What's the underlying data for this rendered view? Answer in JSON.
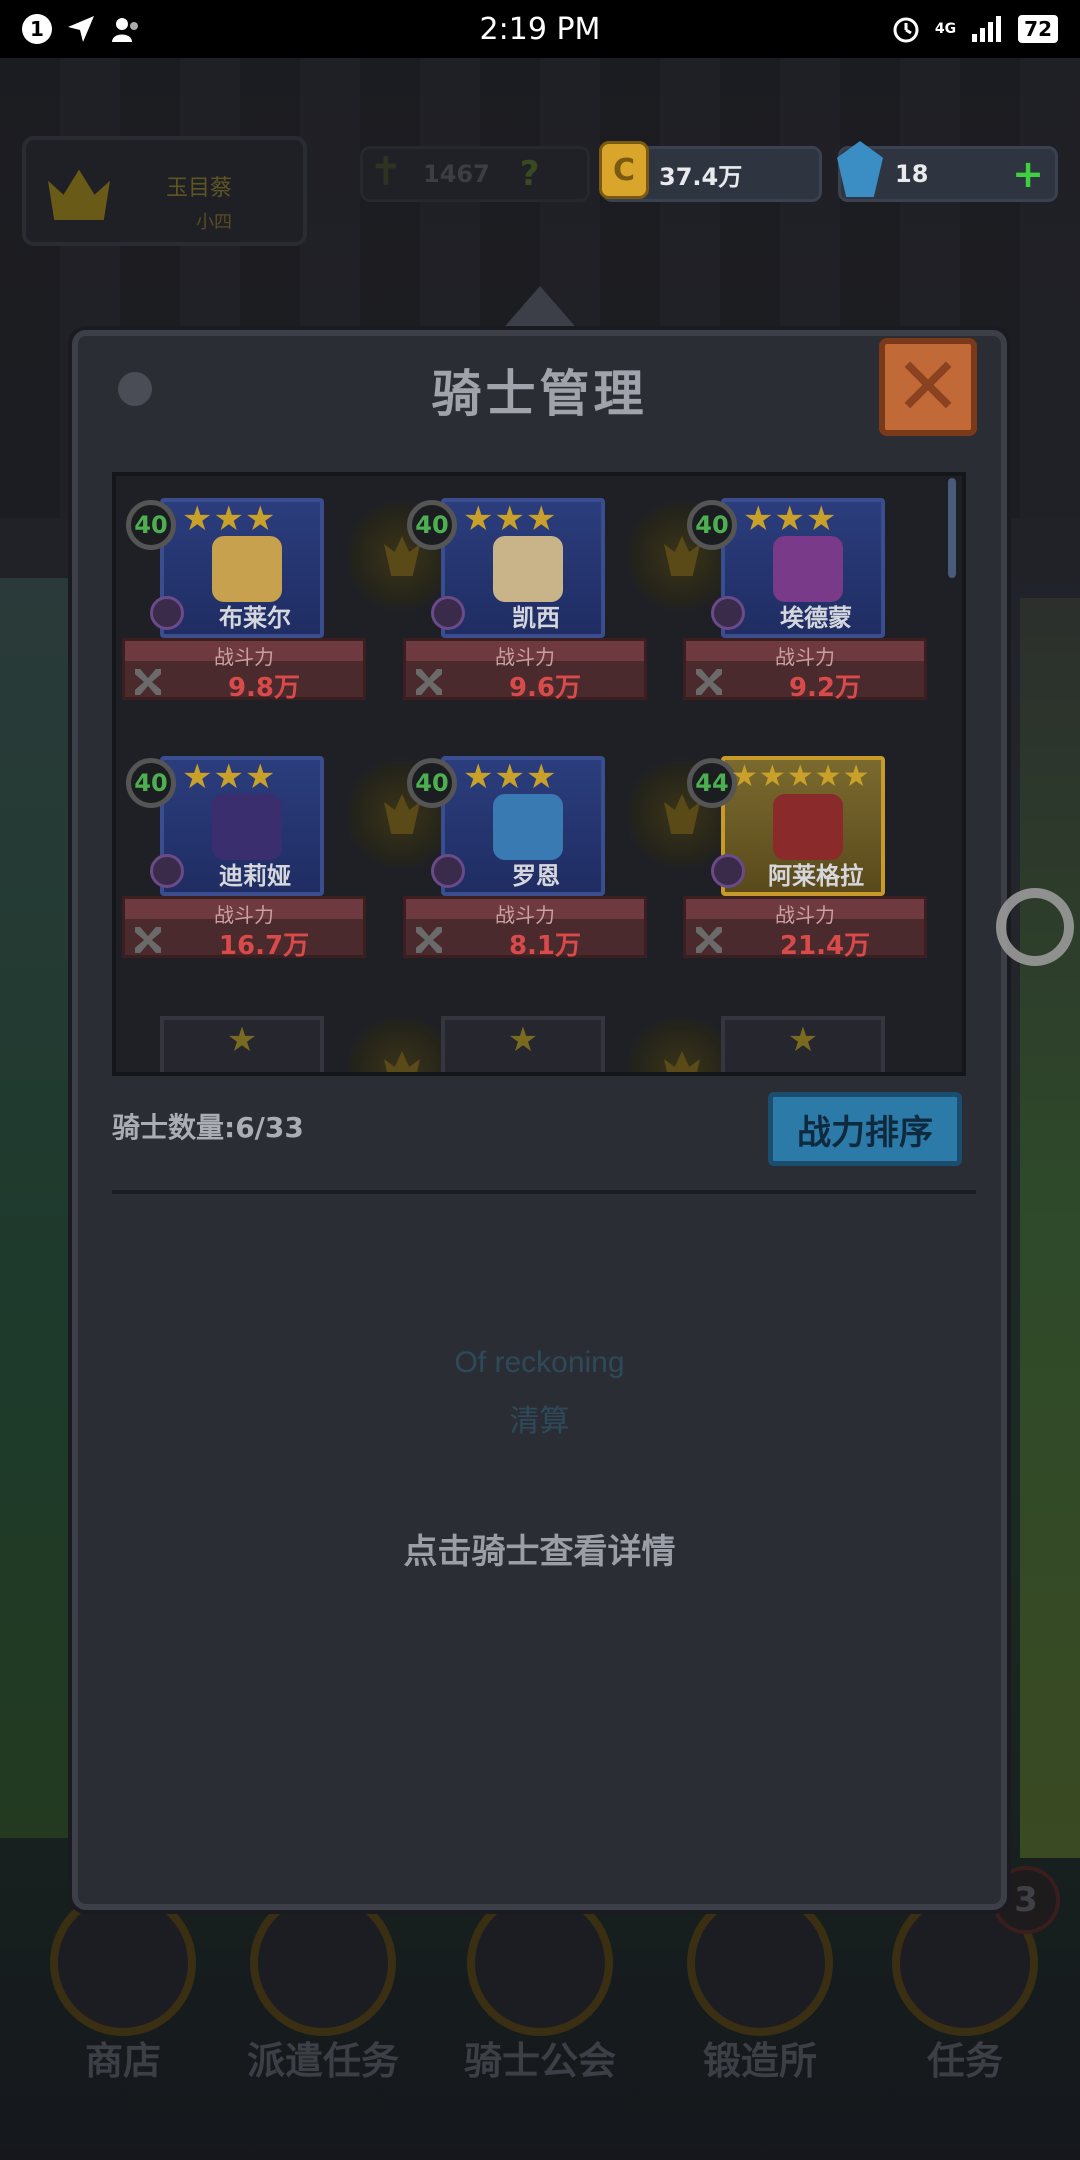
{
  "status_bar": {
    "notification_count": "1",
    "time": "2:19 PM",
    "network": "4G",
    "battery": "72"
  },
  "resources": {
    "player_name": "玉目蔡",
    "player_sub": "小四",
    "power_total": "1467",
    "power_help": "?",
    "gold": "37.4万",
    "gems": "18",
    "gem_plus": "+"
  },
  "modal": {
    "title": "骑士管理",
    "close_label": "✕",
    "knight_count": "骑士数量:6/33",
    "sort_button": "战力排序",
    "reference_en": "Of reckoning",
    "reference_cn": "清算",
    "hint": "点击骑士查看详情"
  },
  "knights": [
    {
      "level": "40",
      "stars": "★★★",
      "name": "布莱尔",
      "power_label": "战斗力",
      "power": "9.8万"
    },
    {
      "level": "40",
      "stars": "★★★",
      "name": "凯西",
      "power_label": "战斗力",
      "power": "9.6万"
    },
    {
      "level": "40",
      "stars": "★★★",
      "name": "埃德蒙",
      "power_label": "战斗力",
      "power": "9.2万"
    },
    {
      "level": "40",
      "stars": "★★★",
      "name": "迪莉娅",
      "power_label": "战斗力",
      "power": "16.7万"
    },
    {
      "level": "40",
      "stars": "★★★",
      "name": "罗恩",
      "power_label": "战斗力",
      "power": "8.1万"
    },
    {
      "level": "44",
      "stars": "★★★★★",
      "name": "阿莱格拉",
      "power_label": "战斗力",
      "power": "21.4万"
    }
  ],
  "empty_slots": [
    "★",
    "★",
    "★"
  ],
  "bottom_nav": [
    {
      "label": "商店"
    },
    {
      "label": "派遣任务"
    },
    {
      "label": "骑士公会"
    },
    {
      "label": "锻造所"
    },
    {
      "label": "任务",
      "badge": "3"
    }
  ],
  "colors": {
    "accent_blue": "#2c7aa8",
    "close_orange": "#c26a37",
    "power_red": "#d94a4a",
    "level_green": "#4caf50",
    "star_gold": "#c9a12a"
  }
}
